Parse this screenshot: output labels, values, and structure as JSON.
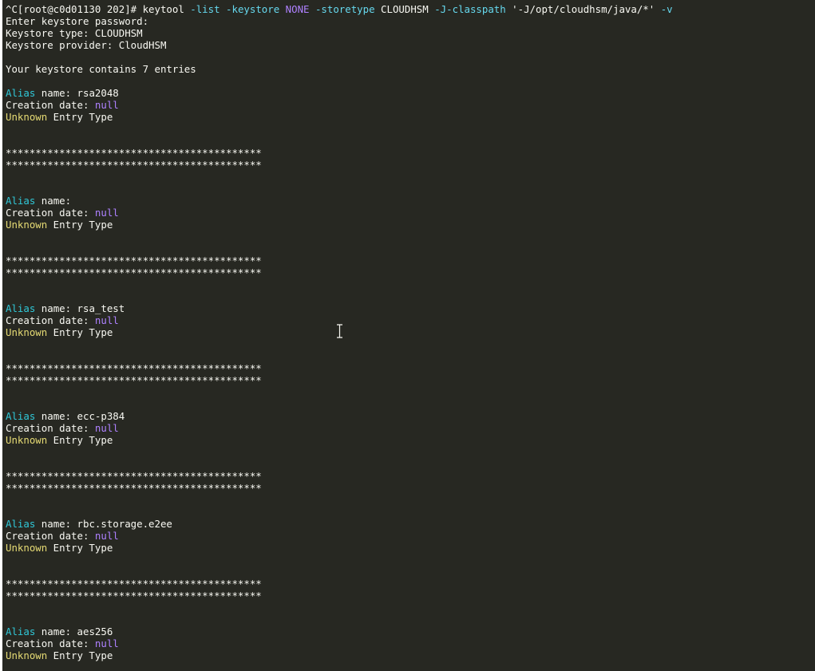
{
  "terminal": {
    "command": {
      "prefix": "^C[root@c0d01130 202]# keytool ",
      "list_flag": "-list",
      "keystore_flag": "-keystore",
      "keystore_value": "NONE",
      "storetype_flag": "-storetype",
      "storetype_value": " CLOUDHSM ",
      "classpath_flag": "-J-classpath",
      "classpath_value": " '-J/opt/cloudhsm/java/*' ",
      "verbose_flag": "-v"
    },
    "header": {
      "password_prompt": "Enter keystore password:",
      "keystore_type": "Keystore type: CLOUDHSM",
      "keystore_provider": "Keystore provider: CloudHSM",
      "entries_summary": "Your keystore contains 7 entries"
    },
    "labels": {
      "alias_word": "Alias",
      "name_suffix": " name: ",
      "creation_date": "Creation date: ",
      "null_value": "null",
      "unknown_word": "Unknown",
      "entry_type_suffix": " Entry Type"
    },
    "separator": "*******************************************",
    "entries": [
      {
        "alias": "rsa2048"
      },
      {
        "alias": ""
      },
      {
        "alias": "rsa_test"
      },
      {
        "alias": "ecc-p384"
      },
      {
        "alias": "rbc.storage.e2ee"
      },
      {
        "alias": "aes256"
      }
    ],
    "colors": {
      "background": "#272822",
      "foreground": "#f8f8f2",
      "flag": "#66d9ef",
      "constant": "#ae81ff",
      "alias_label": "#30c8d8",
      "unknown_label": "#e6db74"
    }
  }
}
